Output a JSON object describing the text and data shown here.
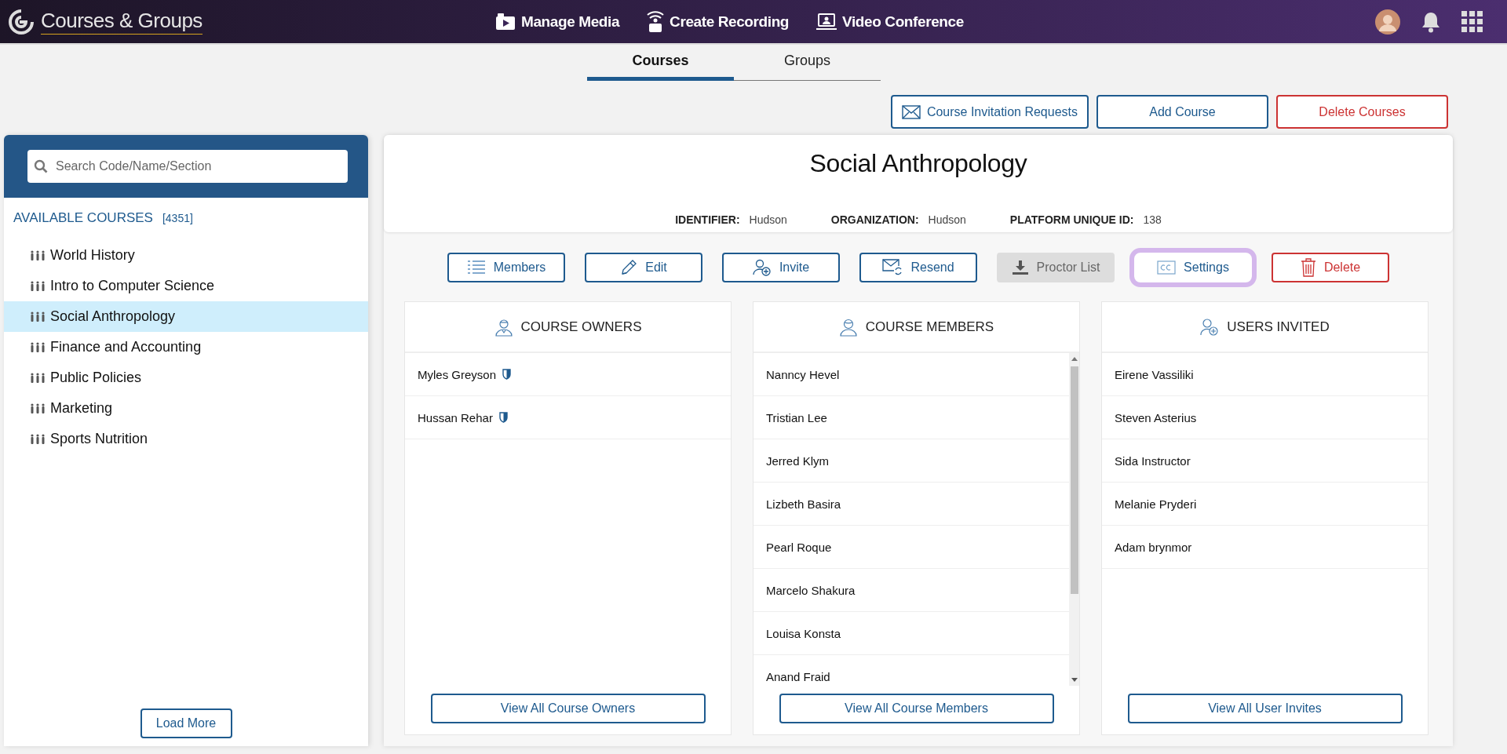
{
  "app_bar": {
    "title": "Courses & Groups",
    "nav": [
      {
        "label": "Manage Media"
      },
      {
        "label": "Create Recording"
      },
      {
        "label": "Video Conference"
      }
    ]
  },
  "tabs": [
    {
      "label": "Courses",
      "selected": true
    },
    {
      "label": "Groups",
      "selected": false
    }
  ],
  "toolbar": {
    "buttons": [
      {
        "label": "Course Invitation Requests",
        "kind": "primary"
      },
      {
        "label": "Add Course",
        "kind": "primary"
      },
      {
        "label": "Delete Courses",
        "kind": "danger"
      }
    ]
  },
  "sidebar": {
    "search": {
      "placeholder": "Search Code/Name/Section"
    },
    "heading": "AVAILABLE COURSES",
    "count": "[4351]",
    "items": [
      {
        "label": "World History",
        "selected": false
      },
      {
        "label": "Intro to Computer Science",
        "selected": false
      },
      {
        "label": "Social Anthropology",
        "selected": true
      },
      {
        "label": "Finance and Accounting",
        "selected": false
      },
      {
        "label": "Public Policies",
        "selected": false
      },
      {
        "label": "Marketing",
        "selected": false
      },
      {
        "label": "Sports Nutrition",
        "selected": false
      }
    ],
    "load_more": "Load More"
  },
  "course": {
    "title": "Social Anthropology",
    "details": [
      {
        "label": "IDENTIFIER:",
        "value": "Hudson"
      },
      {
        "label": "ORGANIZATION:",
        "value": "Hudson"
      },
      {
        "label": "PLATFORM UNIQUE ID:",
        "value": "138"
      }
    ],
    "actions": [
      {
        "label": "Members",
        "kind": "primary",
        "focused": false
      },
      {
        "label": "Edit",
        "kind": "primary",
        "focused": false
      },
      {
        "label": "Invite",
        "kind": "primary",
        "focused": false
      },
      {
        "label": "Resend",
        "kind": "primary",
        "focused": false
      },
      {
        "label": "Proctor List",
        "kind": "disabled",
        "focused": false
      },
      {
        "label": "Settings",
        "kind": "primary",
        "focused": true
      },
      {
        "label": "Delete",
        "kind": "danger",
        "focused": false
      }
    ],
    "columns": [
      {
        "title": "COURSE OWNERS",
        "scrollable": false,
        "button": "View All Course Owners",
        "people": [
          {
            "name": "Myles Greyson",
            "shield": true
          },
          {
            "name": "Hussan Rehar",
            "shield": true
          }
        ]
      },
      {
        "title": "COURSE MEMBERS",
        "scrollable": true,
        "button": "View All Course Members",
        "people": [
          {
            "name": "Nanncy Hevel",
            "shield": false
          },
          {
            "name": "Tristian Lee",
            "shield": false
          },
          {
            "name": "Jerred Klym",
            "shield": false
          },
          {
            "name": "Lizbeth Basira",
            "shield": false
          },
          {
            "name": "Pearl Roque",
            "shield": false
          },
          {
            "name": "Marcelo Shakura",
            "shield": false
          },
          {
            "name": "Louisa Konsta",
            "shield": false
          },
          {
            "name": "Anand Fraid",
            "shield": false
          }
        ]
      },
      {
        "title": "USERS INVITED",
        "scrollable": false,
        "button": "View All User Invites",
        "people": [
          {
            "name": "Eirene Vassiliki",
            "shield": false
          },
          {
            "name": "Steven Asterius",
            "shield": false
          },
          {
            "name": "Sida Instructor",
            "shield": false
          },
          {
            "name": "Melanie Pryderi",
            "shield": false
          },
          {
            "name": "Adam brynmor",
            "shield": false
          }
        ]
      }
    ]
  }
}
